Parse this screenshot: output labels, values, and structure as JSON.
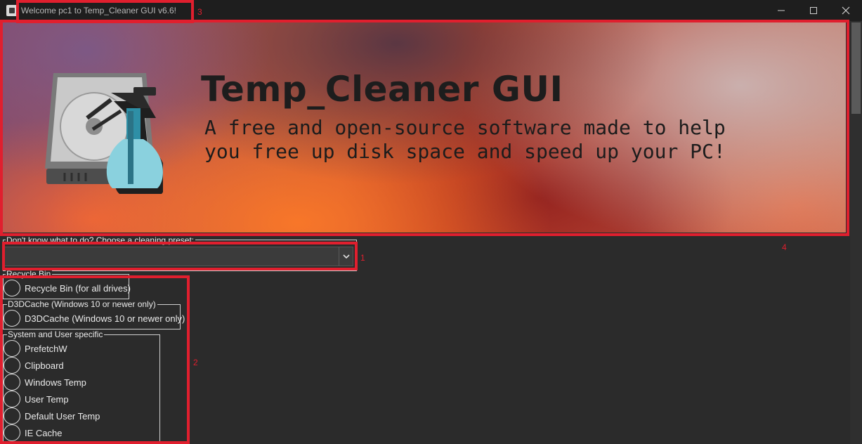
{
  "window": {
    "title": "Welcome pc1 to Temp_Cleaner GUI v6.6!",
    "icon": "app-icon",
    "controls": [
      "minimize-icon",
      "maximize-icon",
      "close-icon"
    ]
  },
  "banner": {
    "title": "Temp_Cleaner GUI",
    "subtitle": "A free and open-source software made to help you free up disk space and speed up your PC!",
    "art": "hard-drive-spray-bottle-icon"
  },
  "preset": {
    "label": "Don't know what to do?  Choose a cleaning preset:",
    "selected": "",
    "arrow_icon": "chevron-down-icon"
  },
  "groups": {
    "recycle_bin": {
      "label": "Recycle Bin",
      "options": [
        "Recycle Bin (for all drives)"
      ]
    },
    "d3dcache": {
      "label": "D3DCache (Windows 10 or newer only)",
      "options": [
        "D3DCache (Windows 10 or newer only)"
      ]
    },
    "system_user": {
      "label": "System and User specific",
      "options": [
        "PrefetchW",
        "Clipboard",
        "Windows Temp",
        "User Temp",
        "Default User Temp",
        "IE Cache"
      ]
    }
  },
  "annotations": [
    "1",
    "2",
    "3",
    "4"
  ],
  "colors": {
    "annotation": "#e01f2e",
    "background": "#2b2b2b",
    "titlebar": "#1e1e1e"
  }
}
